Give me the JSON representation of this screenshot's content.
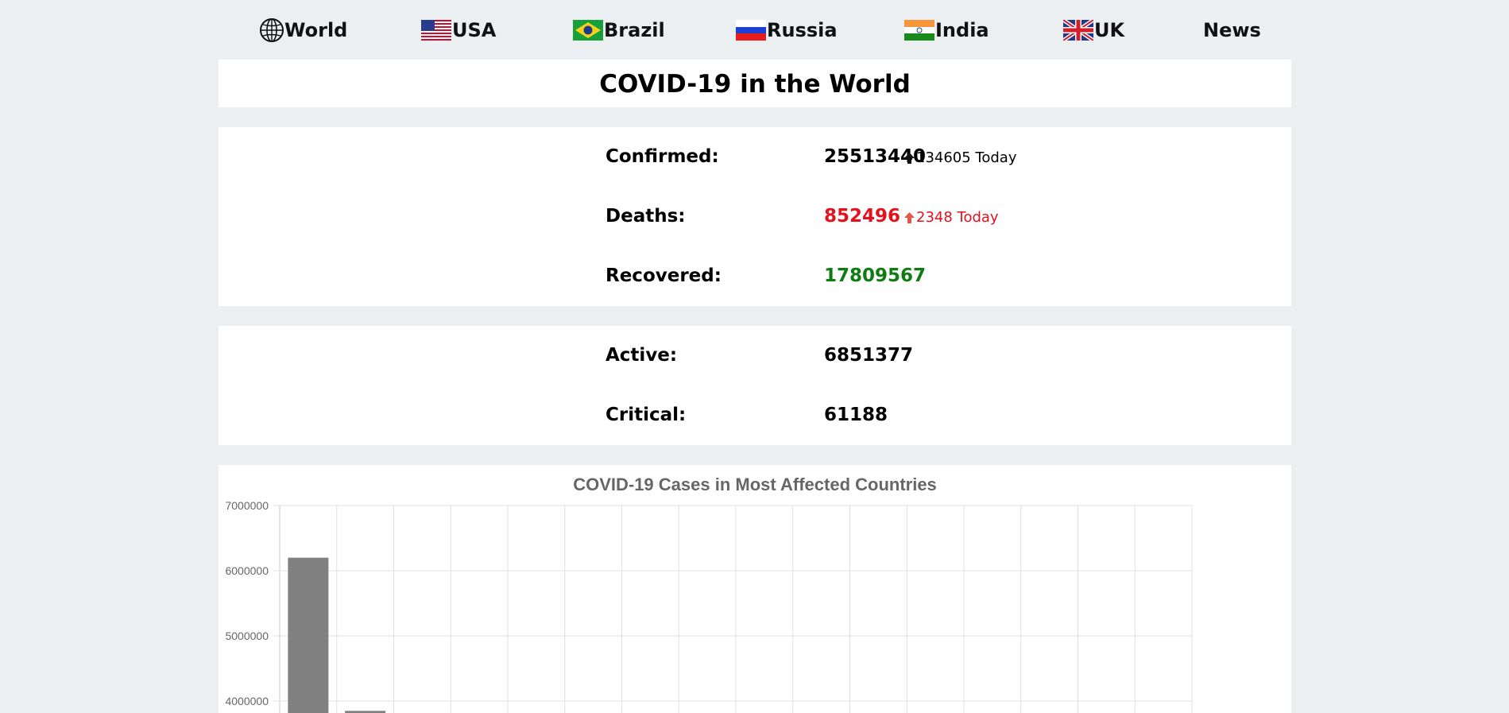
{
  "nav": {
    "items": [
      {
        "label": "World",
        "icon": "globe-icon"
      },
      {
        "label": "USA",
        "icon": "usa-flag-icon"
      },
      {
        "label": "Brazil",
        "icon": "brazil-flag-icon"
      },
      {
        "label": "Russia",
        "icon": "russia-flag-icon"
      },
      {
        "label": "India",
        "icon": "india-flag-icon"
      },
      {
        "label": "UK",
        "icon": "uk-flag-icon"
      },
      {
        "label": "News",
        "icon": ""
      }
    ]
  },
  "header": {
    "title": "COVID-19 in the World"
  },
  "stats": {
    "confirmed": {
      "label": "Confirmed:",
      "value": "25513440",
      "today": "134605 Today"
    },
    "deaths": {
      "label": "Deaths:",
      "value": "852496",
      "today": "2348 Today"
    },
    "recovered": {
      "label": "Recovered:",
      "value": "17809567"
    },
    "active": {
      "label": "Active:",
      "value": "6851377"
    },
    "critical": {
      "label": "Critical:",
      "value": "61188"
    }
  },
  "colors": {
    "background": "#eceff1",
    "card": "#ffffff",
    "deaths": "#e3121c",
    "recovered": "#0f7c10",
    "bar": "#808080",
    "grid": "#e0e0e0"
  },
  "chart_data": {
    "type": "bar",
    "title": "COVID-19 Cases in Most Affected Countries",
    "categories": [
      "",
      "",
      "",
      "",
      "",
      "",
      "",
      "",
      "",
      "",
      "",
      "",
      "",
      "",
      "",
      "",
      ""
    ],
    "values": [
      6200000,
      3850000
    ],
    "ylim": [
      0,
      7000000
    ],
    "yticks": [
      "7000000",
      "6000000",
      "5000000",
      "4000000"
    ],
    "grid": true,
    "legend": "none"
  }
}
